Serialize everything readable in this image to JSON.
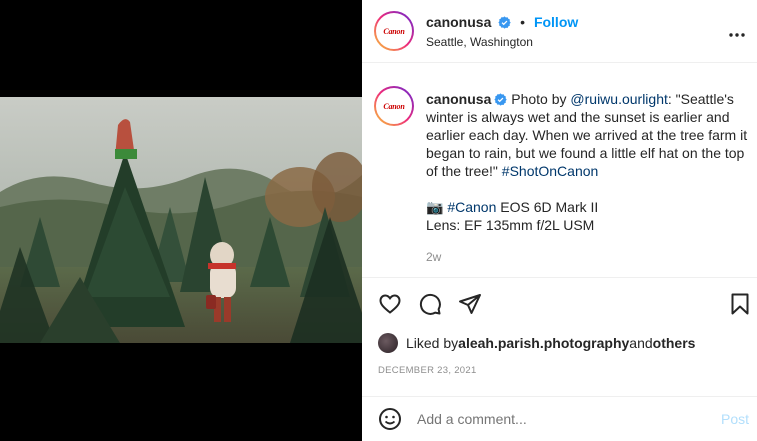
{
  "header": {
    "username": "canonusa",
    "dot": "•",
    "follow_label": "Follow",
    "location": "Seattle, Washington",
    "avatar_logo": "Canon",
    "more_icon": "more-horizontal-icon"
  },
  "caption": {
    "username": "canonusa",
    "text_prefix": "Photo by ",
    "mention": "@ruiwu.ourlight",
    "text_body": ": \"Seattle's winter is always wet and the sunset is earlier and earlier each day. When we arrived at the tree farm it began to rain, but we found a little elf hat on the top of the tree!\" ",
    "hashtag": "#ShotOnCanon",
    "camera_emoji": "📷",
    "camera_hashtag": "#Canon",
    "camera_model": " EOS 6D Mark II",
    "lens": "Lens: EF 135mm f/2L USM",
    "time_ago": "2w"
  },
  "actions": {
    "like_icon": "heart-icon",
    "comment_icon": "comment-icon",
    "share_icon": "send-icon",
    "save_icon": "bookmark-icon"
  },
  "likes": {
    "prefix": "Liked by ",
    "user": "aleah.parish.photography",
    "middle": " and ",
    "others": "others"
  },
  "post_date": "DECEMBER 23, 2021",
  "comment": {
    "placeholder": "Add a comment...",
    "post_label": "Post",
    "emoji_icon": "smiley-icon"
  },
  "colors": {
    "link": "#00376b",
    "follow": "#0095f6",
    "muted": "#8e8e8e",
    "post_disabled": "#b2dffc"
  }
}
